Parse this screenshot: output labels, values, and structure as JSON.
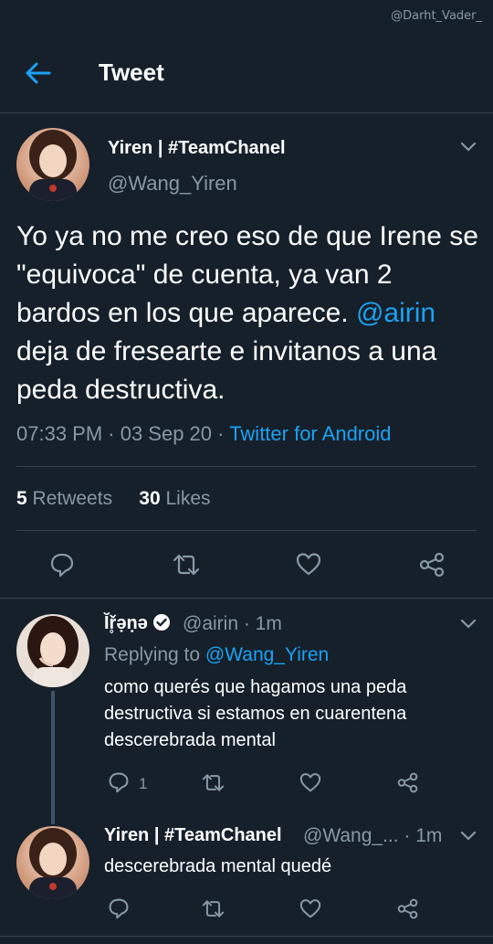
{
  "watermark": "@Darht_Vader_",
  "header": {
    "title": "Tweet"
  },
  "tweet": {
    "author_name": "Yiren | #TeamChanel",
    "author_handle": "@Wang_Yiren",
    "text_part1": "Yo ya no me creo eso de que Irene se \"equivoca\" de cuenta, ya van 2 bardos en los que aparece. ",
    "mention": "@airin",
    "text_part2": " deja de fresearte e invitanos a una peda destructiva.",
    "meta_time": "07:33 PM · 03 Sep 20 · ",
    "meta_client": "Twitter for Android",
    "retweets_count": "5",
    "retweets_label": "Retweets",
    "likes_count": "30",
    "likes_label": "Likes"
  },
  "replies": [
    {
      "author_name": "Ĭř̥ə̣ṇə",
      "author_handle": "@airin · 1m",
      "replying_prefix": "Replying to ",
      "replying_to": "@Wang_Yiren",
      "text": "como querés que hagamos una peda destructiva si estamos en cuarentena descerebrada mental",
      "reply_count": "1"
    },
    {
      "author_name": "Yiren | #TeamChanel",
      "author_handle": "@Wang_... · 1m",
      "text": "descerebrada mental quedé"
    }
  ],
  "colors": {
    "background": "#15202b",
    "accent": "#1da1f2",
    "secondary_text": "#8899a6",
    "divider": "#38444d"
  },
  "icons": [
    "back-arrow-icon",
    "chevron-down-icon",
    "reply-icon",
    "retweet-icon",
    "like-icon",
    "share-icon",
    "verified-icon"
  ]
}
